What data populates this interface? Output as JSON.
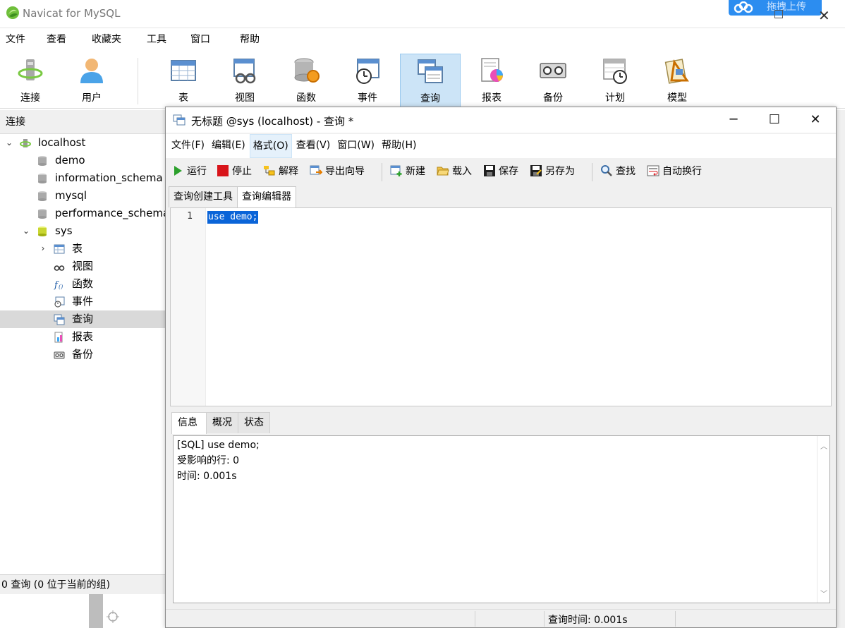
{
  "app": {
    "title": "Navicat for MySQL",
    "baidu_label": "拖拽上传"
  },
  "main_menu": [
    "文件",
    "查看",
    "收藏夹",
    "工具",
    "窗口",
    "帮助"
  ],
  "main_toolbar": [
    {
      "label": "连接",
      "icon": "connection-icon"
    },
    {
      "label": "用户",
      "icon": "user-icon"
    },
    {
      "label": "表",
      "icon": "table-icon"
    },
    {
      "label": "视图",
      "icon": "view-icon"
    },
    {
      "label": "函数",
      "icon": "function-icon"
    },
    {
      "label": "事件",
      "icon": "event-icon"
    },
    {
      "label": "查询",
      "icon": "query-icon",
      "active": true
    },
    {
      "label": "报表",
      "icon": "report-icon"
    },
    {
      "label": "备份",
      "icon": "backup-icon"
    },
    {
      "label": "计划",
      "icon": "schedule-icon"
    },
    {
      "label": "模型",
      "icon": "model-icon"
    }
  ],
  "left_panel": {
    "header": "连接",
    "tree": [
      {
        "label": "localhost",
        "icon": "server-icon",
        "arrow": "expanded",
        "level": 0
      },
      {
        "label": "demo",
        "icon": "database-icon",
        "level": 1
      },
      {
        "label": "information_schema",
        "icon": "database-icon",
        "level": 1
      },
      {
        "label": "mysql",
        "icon": "database-icon",
        "level": 1
      },
      {
        "label": "performance_schema",
        "icon": "database-icon",
        "level": 1
      },
      {
        "label": "sys",
        "icon": "database-open-icon",
        "arrow": "expanded",
        "level": 1
      },
      {
        "label": "表",
        "icon": "table-icon",
        "arrow": "collapsed",
        "level": 2
      },
      {
        "label": "视图",
        "icon": "view-icon",
        "level": 2
      },
      {
        "label": "函数",
        "icon": "function-icon",
        "level": 2
      },
      {
        "label": "事件",
        "icon": "event-icon",
        "level": 2
      },
      {
        "label": "查询",
        "icon": "query-icon",
        "level": 2,
        "selected": true
      },
      {
        "label": "报表",
        "icon": "report-icon",
        "level": 2
      },
      {
        "label": "备份",
        "icon": "backup-icon",
        "level": 2
      }
    ],
    "status": "0 查询 (0 位于当前的组)"
  },
  "query_window": {
    "title": "无标题 @sys (localhost) - 查询 *",
    "menu": [
      {
        "label": "文件(F)"
      },
      {
        "label": "编辑(E)"
      },
      {
        "label": "格式(O)",
        "hot": true
      },
      {
        "label": "查看(V)"
      },
      {
        "label": "窗口(W)"
      },
      {
        "label": "帮助(H)"
      }
    ],
    "toolbar": {
      "run": "运行",
      "stop": "停止",
      "explain": "解释",
      "export": "导出向导",
      "new": "新建",
      "load": "载入",
      "save": "保存",
      "save_as": "另存为",
      "find": "查找",
      "wrap": "自动换行"
    },
    "tabs": [
      "查询创建工具",
      "查询编辑器"
    ],
    "editor": {
      "line_number": "1",
      "code": "use demo;"
    },
    "info_tabs": [
      "信息",
      "概况",
      "状态"
    ],
    "info_lines": [
      "[SQL] use demo;",
      "受影响的行: 0",
      "时间: 0.001s"
    ],
    "status": "查询时间: 0.001s"
  }
}
